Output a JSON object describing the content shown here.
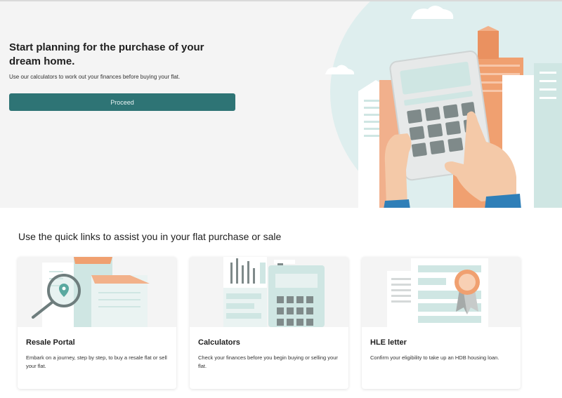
{
  "hero": {
    "title": "Start planning for the purchase of your dream home.",
    "subtitle": "Use our calculators to work out your finances before buying your flat.",
    "proceed_label": "Proceed"
  },
  "quick_links": {
    "heading": "Use the quick links to assist you in your flat purchase or sale",
    "cards": [
      {
        "title": "Resale Portal",
        "description": "Embark on a journey, step by step, to buy a resale flat or sell your flat."
      },
      {
        "title": "Calculators",
        "description": "Check your finances before you begin buying or selling your flat."
      },
      {
        "title": "HLE letter",
        "description": "Confirm your eligibility to take up an HDB housing loan."
      }
    ]
  },
  "colors": {
    "accent": "#2e7475",
    "teal_light": "#cfe6e3",
    "orange": "#ef9b6b",
    "skin": "#f4c9a8",
    "sleeve": "#2f7fb8"
  },
  "icons": [
    "calculator-illustration",
    "hands-illustration",
    "buildings-illustration",
    "magnifier-icon",
    "location-pin-icon",
    "bar-chart-illustration",
    "document-illustration",
    "ribbon-seal-icon",
    "cloud-icon"
  ]
}
